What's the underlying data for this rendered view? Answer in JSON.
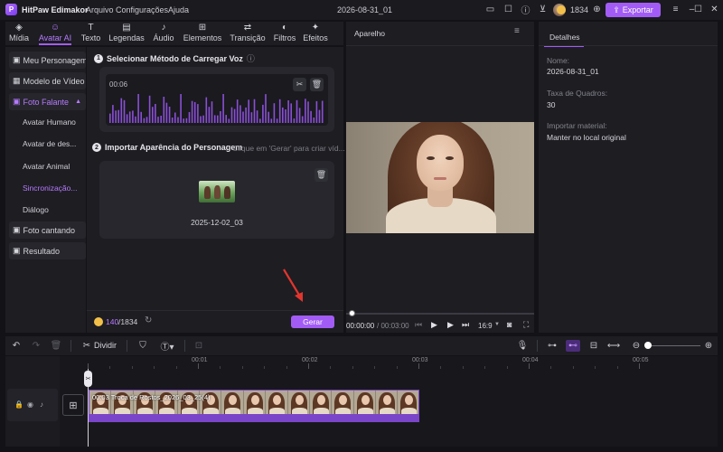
{
  "app": {
    "name": "HitPaw Edimakor",
    "menu": [
      "Arquivo",
      "Configurações",
      "Ajuda"
    ],
    "project_title": "2026-08-31_01",
    "credits": "1834",
    "export_label": "Exportar"
  },
  "tools": [
    {
      "icon": "media-icon",
      "glyph": "◈",
      "label": "Mídia"
    },
    {
      "icon": "avatar-ai-icon",
      "glyph": "☺",
      "label": "Avatar AI"
    },
    {
      "icon": "text-icon",
      "glyph": "T",
      "label": "Texto"
    },
    {
      "icon": "captions-icon",
      "glyph": "▤",
      "label": "Legendas"
    },
    {
      "icon": "audio-icon",
      "glyph": "♪",
      "label": "Áudio"
    },
    {
      "icon": "elements-icon",
      "glyph": "⊞",
      "label": "Elementos"
    },
    {
      "icon": "transition-icon",
      "glyph": "⇄",
      "label": "Transição"
    },
    {
      "icon": "filters-icon",
      "glyph": "◐",
      "label": "Filtros"
    },
    {
      "icon": "effects-icon",
      "glyph": "✦",
      "label": "Efeitos"
    }
  ],
  "sidemenu": {
    "items": [
      {
        "label": "Meu Personagem",
        "glyph": "▣"
      },
      {
        "label": "Modelo de Vídeo",
        "glyph": "▦"
      },
      {
        "label": "Foto Falante",
        "glyph": "▣"
      },
      {
        "label": "Foto cantando",
        "glyph": "▣"
      },
      {
        "label": "Resultado",
        "glyph": "▣"
      }
    ],
    "subitems": [
      "Avatar Humano",
      "Avatar de des...",
      "Avatar Animal",
      "Sincronização...",
      "Diálogo"
    ]
  },
  "ai_panel": {
    "step1_num": "1",
    "step1_title": "Selecionar Método de Carregar Voz",
    "audio_time": "00:06",
    "step2_num": "2",
    "step2_title": "Importar Aparência do Personagem",
    "step2_hint": "Clique em 'Gerar' para criar víd...",
    "image_name": "2025-12-02_03",
    "credits_used": "140",
    "credits_total": "/1834",
    "generate_label": "Gerar"
  },
  "preview": {
    "title": "Aparelho",
    "current_time": "00:00:00",
    "total_time": "/ 00:03:00",
    "ratio": "16:9",
    "progress": 0
  },
  "details": {
    "tab_label": "Detalhes",
    "name_label": "Nome:",
    "name_value": "2026-08-31_01",
    "fps_label": "Taxa de Quadros:",
    "fps_value": "30",
    "import_label": "Importar material:",
    "import_value": "Manter no local original"
  },
  "timeline": {
    "split_label": "Dividir",
    "ruler": [
      "00:00",
      "00:01",
      "00:02",
      "00:03",
      "00:04",
      "00:05"
    ],
    "clip_label": "00:03  Troca de Rostos_2026_03_25(4)"
  },
  "colors": {
    "accent": "#a25cf5",
    "wave": "#8a4fd6",
    "clip_bar": "#7b45c9"
  }
}
